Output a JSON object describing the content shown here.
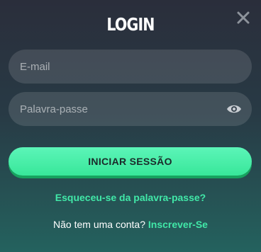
{
  "modal": {
    "title": "LOGIN",
    "close_icon": "close-icon"
  },
  "form": {
    "email_placeholder": "E-mail",
    "password_placeholder": "Palavra-passe",
    "password_toggle_icon": "eye-icon",
    "submit_label": "INICIAR SESSÃO",
    "forgot_label": "Esqueceu-se da palavra-passe?",
    "no_account_text": "Não tem uma conta?",
    "signup_label": "Inscrever-Se"
  },
  "colors": {
    "accent": "#41e8a8",
    "button": "#38e79a",
    "button_text": "#1b2a2a"
  }
}
